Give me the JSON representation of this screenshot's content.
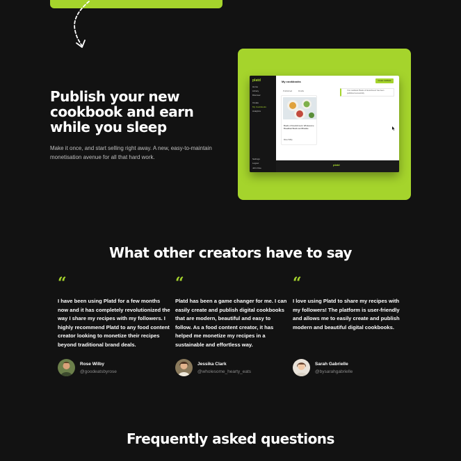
{
  "colors": {
    "background": "#121212",
    "accent": "#a5d42c",
    "text": "#ffffff",
    "muted": "#bfbfbf"
  },
  "publish": {
    "heading": "Publish your new cookbook and earn while you sleep",
    "body": "Make it once, and start selling right away. A new, easy-to-maintain monetisation avenue for all that hard work."
  },
  "app_screenshot": {
    "logo": "platd",
    "nav": [
      "Home",
      "Library",
      "Discover",
      "Create",
      "My Cookbooks",
      "Analytics"
    ],
    "nav_bottom": [
      "Settings",
      "Logout",
      "John Doe"
    ],
    "title": "My cookbooks",
    "button": "Create cookbook",
    "tabs": [
      "Published",
      "Drafts"
    ],
    "notice": "Your cookbook 'Bowls of Nourishment' has been published successfully",
    "recipe_title": "Bowls of Nourishment: Wholesome Breakfast Bowls and Brekkie",
    "recipe_author": "Rose Wilby",
    "footer_logo": "platd"
  },
  "testimonials": {
    "heading": "What other creators have to say",
    "quote_mark": "“",
    "items": [
      {
        "text": "I have been using Platd for a few months now and it has completely revolutionized the way I share my recipes with my followers. I highly recommend Platd to any food content creator looking to monetize their recipes beyond traditional brand deals.",
        "name": "Rose Wilby",
        "handle": "@goodeatsbyrose",
        "avatar_icon": "avatar-rose"
      },
      {
        "text": "Platd has been a game changer for me. I can easily create and publish digital cookbooks that are modern, beautiful and easy to follow. As a food content creator, it has helped me monetize my recipes in a sustainable and effortless way.",
        "name": "Jessika Clark",
        "handle": "@wholesome_hearty_eats",
        "avatar_icon": "avatar-jessika"
      },
      {
        "text": "I love using Platd to share my recipes with my followers! The platform is user-friendly and allows me to easily create and publish modern and beautiful digital cookbooks.",
        "name": "Sarah Gabrielle",
        "handle": "@bysarahgabrielle",
        "avatar_icon": "avatar-sarah"
      }
    ]
  },
  "faq": {
    "heading": "Frequently asked questions"
  }
}
